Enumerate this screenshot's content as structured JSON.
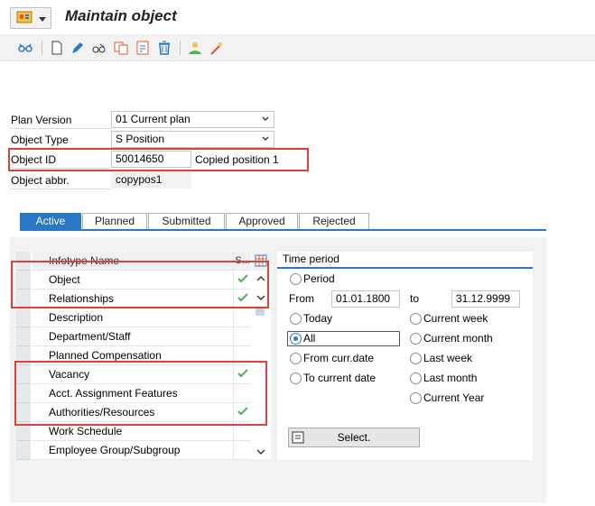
{
  "window": {
    "title": "Maintain object"
  },
  "toolbar": {
    "icons": [
      "glasses-icon",
      "new-document-icon",
      "edit-pencil-icon",
      "display-icon",
      "copy-icon",
      "delimit-icon",
      "delete-icon",
      "overview-icon",
      "wand-icon"
    ]
  },
  "form": {
    "plan_version": {
      "label": "Plan Version",
      "value": "01 Current plan"
    },
    "object_type": {
      "label": "Object Type",
      "value": "S Position"
    },
    "object_id": {
      "label": "Object ID",
      "value": "50014650",
      "name": "Copied position 1"
    },
    "object_abbr": {
      "label": "Object abbr.",
      "value": "copypos1"
    }
  },
  "tabs": [
    {
      "label": "Active",
      "active": true
    },
    {
      "label": "Planned",
      "active": false
    },
    {
      "label": "Submitted",
      "active": false
    },
    {
      "label": "Approved",
      "active": false
    },
    {
      "label": "Rejected",
      "active": false
    }
  ],
  "infotypes": {
    "header": {
      "name": "Infotype Name",
      "status": "S..."
    },
    "rows": [
      {
        "name": "Object",
        "status": true
      },
      {
        "name": "Relationships",
        "status": true
      },
      {
        "name": "Description",
        "status": false
      },
      {
        "name": "Department/Staff",
        "status": false
      },
      {
        "name": "Planned Compensation",
        "status": false
      },
      {
        "name": "Vacancy",
        "status": true
      },
      {
        "name": "Acct. Assignment Features",
        "status": false
      },
      {
        "name": "Authorities/Resources",
        "status": true
      },
      {
        "name": "Work Schedule",
        "status": false
      },
      {
        "name": "Employee Group/Subgroup",
        "status": false
      }
    ]
  },
  "time_period": {
    "title": "Time period",
    "period_label": "Period",
    "from_label": "From",
    "from_value": "01.01.1800",
    "to_label": "to",
    "to_value": "31.12.9999",
    "options_left": [
      {
        "label": "Today",
        "selected": false
      },
      {
        "label": "All",
        "selected": true
      },
      {
        "label": "From curr.date",
        "selected": false
      },
      {
        "label": "To current date",
        "selected": false
      }
    ],
    "options_right": [
      {
        "label": "Current week",
        "selected": false
      },
      {
        "label": "Current month",
        "selected": false
      },
      {
        "label": "Last week",
        "selected": false
      },
      {
        "label": "Last month",
        "selected": false
      },
      {
        "label": "Current Year",
        "selected": false
      }
    ],
    "select_button": "Select."
  },
  "colors": {
    "accent": "#2a78c5",
    "highlight": "#e0403a",
    "check": "#4caf50"
  }
}
